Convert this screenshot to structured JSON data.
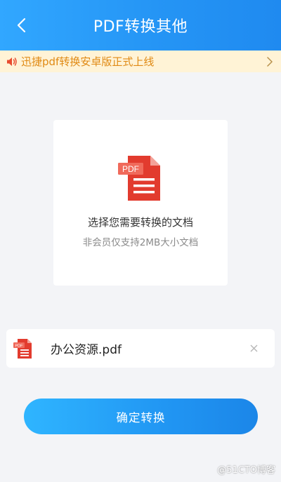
{
  "header": {
    "title": "PDF转换其他",
    "back_icon": "chevron-left-icon"
  },
  "notice": {
    "text": "迅捷pdf转换安卓版正式上线",
    "icon": "speaker-icon",
    "arrow_icon": "chevron-right-icon"
  },
  "upload": {
    "badge": "PDF",
    "title": "选择您需要转换的文档",
    "subtitle": "非会员仅支持2MB大小文档"
  },
  "file": {
    "badge": "PDF",
    "name": "办公资源.pdf",
    "remove_icon": "close-icon"
  },
  "confirm": {
    "label": "确定转换"
  },
  "watermark": {
    "text": "@51CTO博客"
  },
  "colors": {
    "header_start": "#31a7ff",
    "header_end": "#1f8af0",
    "notice_bg": "#fff3d6",
    "notice_text": "#e08a14",
    "pdf_red": "#e23b2e",
    "button_start": "#2fb5ff",
    "button_end": "#1b86e8"
  }
}
